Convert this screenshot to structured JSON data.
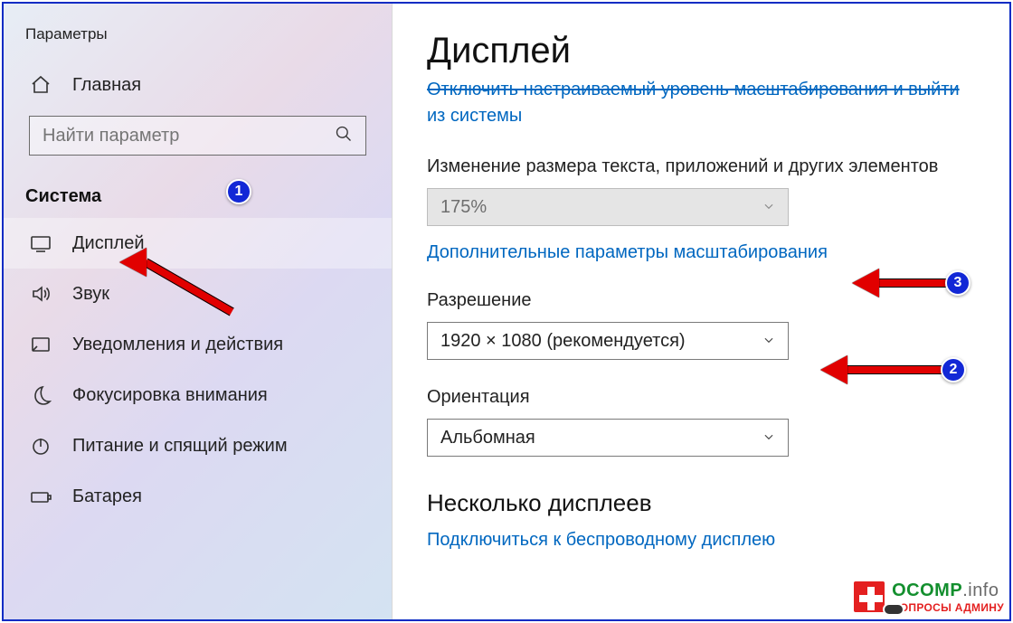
{
  "app_title": "Параметры",
  "sidebar": {
    "home_label": "Главная",
    "search_placeholder": "Найти параметр",
    "section_label": "Система",
    "items": [
      {
        "label": "Дисплей"
      },
      {
        "label": "Звук"
      },
      {
        "label": "Уведомления и действия"
      },
      {
        "label": "Фокусировка внимания"
      },
      {
        "label": "Питание и спящий режим"
      },
      {
        "label": "Батарея"
      }
    ]
  },
  "main": {
    "heading": "Дисплей",
    "truncated_link_line1": "Отключить настраиваемый уровень масштабирования и выйти",
    "truncated_link_line2": "из системы",
    "scale_label": "Изменение размера текста, приложений и других элементов",
    "scale_value": "175%",
    "advanced_scale_link": "Дополнительные параметры масштабирования",
    "resolution_label": "Разрешение",
    "resolution_value": "1920 × 1080 (рекомендуется)",
    "orientation_label": "Ориентация",
    "orientation_value": "Альбомная",
    "multi_display_heading": "Несколько дисплеев",
    "wireless_link": "Подключиться к беспроводному дисплею"
  },
  "annotations": {
    "b1": "1",
    "b2": "2",
    "b3": "3"
  },
  "watermark": {
    "brand": "OCOMP",
    "suffix": ".info",
    "tag": "ВОПРОСЫ АДМИНУ"
  }
}
